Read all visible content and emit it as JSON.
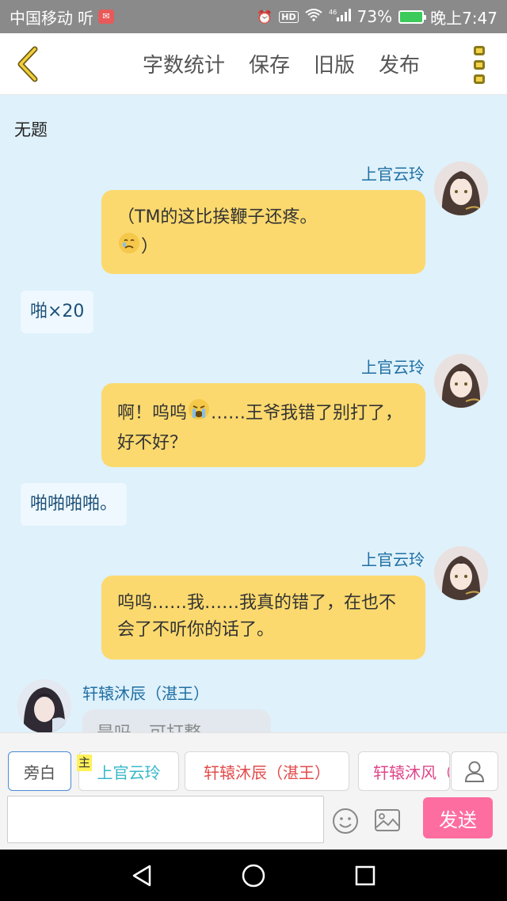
{
  "status_bar": {
    "carrier": "中国移动",
    "carrier_app": "听",
    "signal": "46",
    "battery": "73%",
    "time": "晚上7:47"
  },
  "header": {
    "menu": [
      "字数统计",
      "保存",
      "旧版",
      "发布"
    ]
  },
  "story": {
    "title": "无题"
  },
  "messages": [
    {
      "speaker": "上官云玲",
      "text": "（TM的这比挨鞭子还疼。",
      "text2": "）"
    },
    {
      "narration": "啪×20"
    },
    {
      "speaker": "上官云玲",
      "text_a": "啊！呜呜",
      "text_b": "……王爷我错了别打了，好不好？"
    },
    {
      "narration": "啪啪啪啪。"
    },
    {
      "speaker": "上官云玲",
      "text": "呜呜……我……我真的错了，在也不会了不听你的话了。"
    },
    {
      "speaker": "轩辕沐辰（湛王）",
      "text": "是吗，可打整"
    }
  ],
  "characters": {
    "narrator": "旁白",
    "main_badge": "主",
    "c1": "上官云玲",
    "c2": "轩辕沐辰（湛王）",
    "c3": "轩辕沐风（"
  },
  "input": {
    "value": "",
    "send": "发送"
  },
  "colors": {
    "accent": "#fe6da0",
    "bubble": "#fbd96e",
    "background": "#dff1fb",
    "name": "#1f6fa3"
  }
}
